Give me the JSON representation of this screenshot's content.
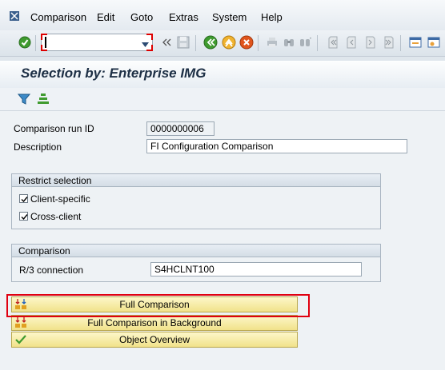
{
  "menu": {
    "items": [
      {
        "label": "Comparison"
      },
      {
        "label": "Edit"
      },
      {
        "label": "Goto"
      },
      {
        "label": "Extras"
      },
      {
        "label": "System"
      },
      {
        "label": "Help"
      }
    ]
  },
  "toolbar": {
    "command_value": "",
    "icons": [
      "enter-icon",
      "command-field",
      "nav-back-chevrons-icon",
      "save-icon",
      "back-icon",
      "exit-icon",
      "cancel-icon",
      "print-icon",
      "find-icon",
      "find-next-icon",
      "first-page-icon",
      "previous-page-icon",
      "next-page-icon",
      "last-page-icon",
      "new-session-icon",
      "shortcut-icon"
    ]
  },
  "title": "Selection by: Enterprise IMG",
  "app_toolbar": {
    "icons": [
      "filter-icon",
      "sort-icon"
    ]
  },
  "form": {
    "run_id_label": "Comparison run ID",
    "run_id_value": "0000000006",
    "description_label": "Description",
    "description_value": "FI Configuration Comparison"
  },
  "restrict": {
    "header": "Restrict selection",
    "client_specific_label": "Client-specific",
    "client_specific_checked": true,
    "cross_client_label": "Cross-client",
    "cross_client_checked": true
  },
  "comparison": {
    "header": "Comparison",
    "connection_label": "R/3 connection",
    "connection_value": "S4HCLNT100"
  },
  "buttons": {
    "full_comparison": "Full Comparison",
    "full_comparison_bg": "Full Comparison in Background",
    "object_overview": "Object Overview"
  },
  "colors": {
    "highlight": "#e00010",
    "button_bg": "#f6eaa0",
    "title": "#1d2f45"
  }
}
